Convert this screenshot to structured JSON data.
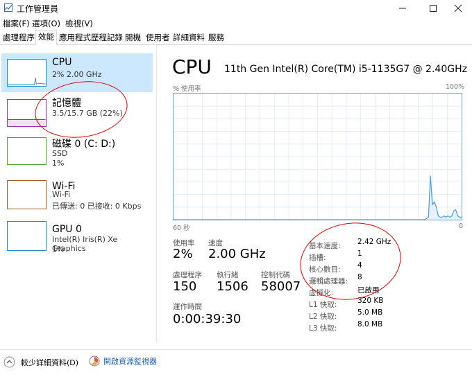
{
  "window": {
    "title": "工作管理員",
    "minimize_icon": "minimize-icon",
    "maximize_icon": "maximize-icon",
    "close_icon": "close-icon"
  },
  "menu": [
    "檔案(F)",
    "選項(O)",
    "檢視(V)"
  ],
  "tabs": [
    "處理程序",
    "效能",
    "應用程式歷程記錄",
    "開機",
    "使用者",
    "詳細資料",
    "服務"
  ],
  "active_tab": "效能",
  "resources": [
    {
      "name": "CPU",
      "line1": "2% 2.00 GHz",
      "line2": "",
      "color": "#1e8cd4"
    },
    {
      "name": "記憶體",
      "line1": "3.5/15.7 GB (22%)",
      "line2": "",
      "color": "#9b2fae"
    },
    {
      "name": "磁碟 0 (C: D:)",
      "line1": "SSD",
      "line2": "1%",
      "color": "#4caf1d"
    },
    {
      "name": "Wi-Fi",
      "line1": "Wi-Fi",
      "line2": "已傳送: 0 已接收: 0 Kbps",
      "color": "#a75d20"
    },
    {
      "name": "GPU 0",
      "line1": "Intel(R) Iris(R) Xe Graphics",
      "line2": "1%",
      "color": "#1e8cd4"
    }
  ],
  "detail": {
    "title": "CPU",
    "model": "11th Gen Intel(R) Core(TM) i5-1135G7 @ 2.40GHz",
    "graph_label": "% 使用率",
    "graph_max": "100%",
    "graph_time": "60 秒",
    "graph_min": "0",
    "utilization_history": [
      0,
      0,
      0,
      0,
      0,
      0,
      0,
      0,
      0,
      0,
      0,
      0,
      0,
      0,
      0,
      0,
      0,
      0,
      0,
      0,
      0,
      0,
      0,
      0,
      0,
      0,
      0,
      0,
      0,
      0,
      0,
      0,
      0,
      0,
      0,
      0,
      0,
      0,
      0,
      0,
      0,
      0,
      0,
      0,
      0,
      0,
      0,
      0,
      0,
      0,
      0,
      0,
      0,
      0,
      0,
      0,
      0,
      0,
      0,
      0,
      0,
      0,
      0,
      0,
      0,
      0,
      0,
      0,
      0,
      0,
      0,
      0,
      0,
      0,
      0,
      0,
      0,
      0,
      0,
      0,
      0,
      0,
      0,
      0,
      0,
      0,
      0,
      0,
      0,
      0,
      0,
      0,
      0,
      0,
      0,
      0,
      0,
      0,
      0,
      0,
      0,
      0,
      0,
      0,
      0,
      0,
      0,
      0,
      0,
      0,
      0,
      0,
      0,
      0,
      0,
      0,
      0,
      0,
      0,
      0,
      0,
      0,
      0,
      0,
      0,
      0,
      0,
      0,
      0,
      0,
      1,
      2,
      35,
      12,
      14,
      10,
      3,
      2,
      2,
      3,
      2,
      3,
      2,
      3,
      7,
      8,
      3,
      2,
      2
    ],
    "stats": [
      {
        "label": "使用率",
        "value": "2%"
      },
      {
        "label": "速度",
        "value": "2.00 GHz"
      },
      {
        "label": "處理程序",
        "value": "150"
      },
      {
        "label": "執行緒",
        "value": "1506"
      },
      {
        "label": "控制代碼",
        "value": "58007"
      },
      {
        "label": "運作時間",
        "value": "0:00:39:30"
      }
    ],
    "specs": [
      {
        "label": "基本速度:",
        "value": "2.42 GHz"
      },
      {
        "label": "插槽:",
        "value": "1"
      },
      {
        "label": "核心數目:",
        "value": "4"
      },
      {
        "label": "邏輯處理器:",
        "value": "8"
      },
      {
        "label": "虛擬化:",
        "value": "已啟用"
      },
      {
        "label": "L1 快取:",
        "value": "320 KB"
      },
      {
        "label": "L2 快取:",
        "value": "5.0 MB"
      },
      {
        "label": "L3 快取:",
        "value": "8.0 MB"
      }
    ]
  },
  "footer": {
    "less_details": "較少詳細資料(D)",
    "open_monitor": "開啟資源監視器"
  }
}
